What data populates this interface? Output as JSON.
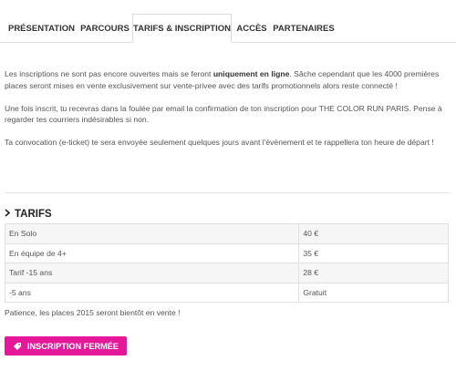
{
  "tabs": [
    {
      "label": "PRÉSENTATION",
      "active": false
    },
    {
      "label": "PARCOURS",
      "active": false
    },
    {
      "label": "TARIFS & INSCRIPTION",
      "active": true
    },
    {
      "label": "ACCÈS",
      "active": false
    },
    {
      "label": "PARTENAIRES",
      "active": false
    }
  ],
  "intro": {
    "p1_before": "Les inscriptions ne sont pas encore ouvertes mais se feront ",
    "p1_strong": "uniquement en ligne",
    "p1_after": ". Sâche cependant que les 4000 premières places seront mises en vente exclusivement sur vente-privee avec des tarifs promotionnels alors reste connecté !",
    "p2": "Une fois inscrit, tu recevras dans la foulée par email  la confirmation de ton inscription pour THE COLOR RUN PARIS. Pense à regarder tes courriers indésirables si non.",
    "p3": "Ta convocation (e-ticket) te sera envoyée seulement quelques jours avant l'évènement et te rappellera ton heure de départ !"
  },
  "tarifs": {
    "heading": "TARIFS",
    "rows": [
      {
        "label": "En Solo",
        "price": "40 €"
      },
      {
        "label": "En équipe de 4+",
        "price": "35 €"
      },
      {
        "label": "Tarif -15 ans",
        "price": "28 €"
      },
      {
        "label": "-5 ans",
        "price": "Gratuit"
      }
    ]
  },
  "patience_text": "Patience, les places 2015 seront bientôt en vente !",
  "button": {
    "label": "INSCRIPTION FERMÉE",
    "icon": "tag-icon",
    "color": "#e5189a"
  },
  "colors": {
    "accent": "#e5189a",
    "text": "#555555",
    "border": "#e0e0e0"
  }
}
